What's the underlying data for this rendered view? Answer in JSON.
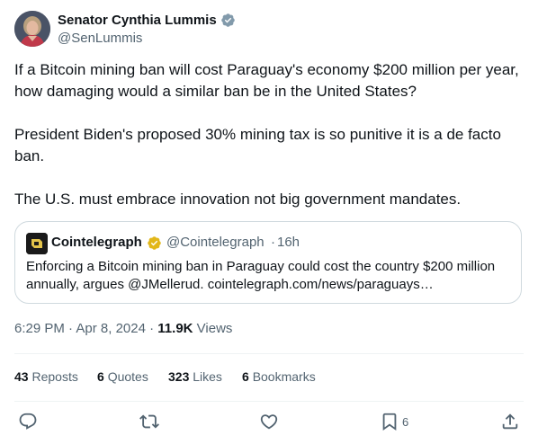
{
  "author": {
    "name": "Senator Cynthia Lummis",
    "handle": "@SenLummis"
  },
  "tweet": {
    "paragraphs": [
      "If a Bitcoin mining ban will cost Paraguay's economy $200 million per year, how damaging would a similar ban be in the United States?",
      "President Biden's proposed 30% mining tax is so punitive it is a de facto ban.",
      "The U.S. must embrace innovation not big government mandates."
    ]
  },
  "quote": {
    "name": "Cointelegraph",
    "handle": "@Cointelegraph",
    "separator": "·",
    "time": "16h",
    "text": "Enforcing a Bitcoin mining ban in Paraguay could cost the country $200 million annually, argues @JMellerud. cointelegraph.com/news/paraguays…"
  },
  "meta": {
    "time": "6:29 PM",
    "separator": "·",
    "date": "Apr 8, 2024",
    "views_count": "11.9K",
    "views_label": "Views"
  },
  "stats": {
    "reposts_count": "43",
    "reposts_label": "Reposts",
    "quotes_count": "6",
    "quotes_label": "Quotes",
    "likes_count": "323",
    "likes_label": "Likes",
    "bookmarks_count": "6",
    "bookmarks_label": "Bookmarks"
  },
  "actions": {
    "bookmark_count": "6"
  },
  "colors": {
    "text": "#0f1419",
    "secondary": "#536471",
    "border": "#cfd9de",
    "divider": "#eff3f4",
    "verified_gray": "#829aab",
    "verified_gold": "#e2b719"
  },
  "icons": {
    "verified_author": "verified-badge-gray-icon",
    "verified_quote": "verified-badge-gold-icon",
    "reply": "reply-icon",
    "repost": "repost-icon",
    "like": "heart-icon",
    "bookmark": "bookmark-icon",
    "share": "share-icon"
  }
}
